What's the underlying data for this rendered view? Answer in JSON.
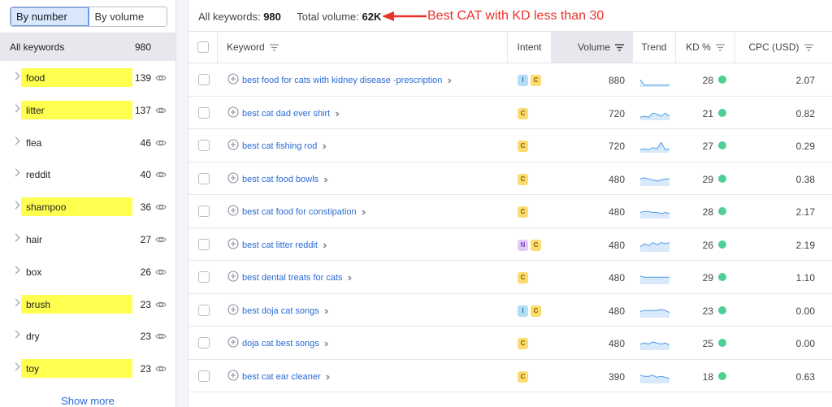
{
  "sidebar": {
    "toggle": {
      "by_number": "By number",
      "by_volume": "By volume"
    },
    "all_keywords": {
      "label": "All keywords",
      "count": "980"
    },
    "groups": [
      {
        "label": "food",
        "count": "139",
        "highlighted": true
      },
      {
        "label": "litter",
        "count": "137",
        "highlighted": true
      },
      {
        "label": "flea",
        "count": "46",
        "highlighted": false
      },
      {
        "label": "reddit",
        "count": "40",
        "highlighted": false
      },
      {
        "label": "shampoo",
        "count": "36",
        "highlighted": true
      },
      {
        "label": "hair",
        "count": "27",
        "highlighted": false
      },
      {
        "label": "box",
        "count": "26",
        "highlighted": false
      },
      {
        "label": "brush",
        "count": "23",
        "highlighted": true
      },
      {
        "label": "dry",
        "count": "23",
        "highlighted": false
      },
      {
        "label": "toy",
        "count": "23",
        "highlighted": true
      }
    ],
    "show_more": "Show more"
  },
  "summary": {
    "all_keywords_label": "All keywords:",
    "all_keywords_value": "980",
    "total_volume_label": "Total volume:",
    "total_volume_value": "62K",
    "annotation": "Best CAT with KD less than 30"
  },
  "table": {
    "headers": {
      "keyword": "Keyword",
      "intent": "Intent",
      "volume": "Volume",
      "trend": "Trend",
      "kd": "KD %",
      "cpc": "CPC (USD)"
    },
    "rows": [
      {
        "keyword": "best food for cats with kidney disease -prescription",
        "intent": [
          "I",
          "C"
        ],
        "volume": "880",
        "kd": "28",
        "cpc": "2.07",
        "trend": [
          0.6,
          0.1,
          0.1,
          0.1,
          0.1,
          0.1,
          0.1,
          0.1
        ]
      },
      {
        "keyword": "best cat dad ever shirt",
        "intent": [
          "C"
        ],
        "volume": "720",
        "kd": "21",
        "cpc": "0.82",
        "trend": [
          0.2,
          0.3,
          0.2,
          0.6,
          0.5,
          0.3,
          0.6,
          0.3
        ]
      },
      {
        "keyword": "best cat fishing rod",
        "intent": [
          "C"
        ],
        "volume": "720",
        "kd": "27",
        "cpc": "0.29",
        "trend": [
          0.2,
          0.3,
          0.2,
          0.4,
          0.3,
          0.9,
          0.2,
          0.3
        ]
      },
      {
        "keyword": "best cat food bowls",
        "intent": [
          "C"
        ],
        "volume": "480",
        "kd": "29",
        "cpc": "0.38",
        "trend": [
          0.6,
          0.7,
          0.6,
          0.5,
          0.4,
          0.5,
          0.6,
          0.6
        ]
      },
      {
        "keyword": "best cat food for constipation",
        "intent": [
          "C"
        ],
        "volume": "480",
        "kd": "28",
        "cpc": "2.17",
        "trend": [
          0.5,
          0.6,
          0.6,
          0.5,
          0.5,
          0.4,
          0.5,
          0.4
        ]
      },
      {
        "keyword": "best cat litter reddit",
        "intent": [
          "N",
          "C"
        ],
        "volume": "480",
        "kd": "26",
        "cpc": "2.19",
        "trend": [
          0.4,
          0.7,
          0.5,
          0.8,
          0.6,
          0.8,
          0.7,
          0.8
        ]
      },
      {
        "keyword": "best dental treats for cats",
        "intent": [
          "C"
        ],
        "volume": "480",
        "kd": "29",
        "cpc": "1.10",
        "trend": [
          0.7,
          0.6,
          0.6,
          0.6,
          0.6,
          0.6,
          0.6,
          0.6
        ]
      },
      {
        "keyword": "best doja cat songs",
        "intent": [
          "I",
          "C"
        ],
        "volume": "480",
        "kd": "23",
        "cpc": "0.00",
        "trend": [
          0.5,
          0.6,
          0.6,
          0.6,
          0.6,
          0.7,
          0.6,
          0.4
        ]
      },
      {
        "keyword": "doja cat best songs",
        "intent": [
          "C"
        ],
        "volume": "480",
        "kd": "25",
        "cpc": "0.00",
        "trend": [
          0.5,
          0.6,
          0.5,
          0.7,
          0.6,
          0.5,
          0.6,
          0.4
        ]
      },
      {
        "keyword": "best cat ear cleaner",
        "intent": [
          "C"
        ],
        "volume": "390",
        "kd": "18",
        "cpc": "0.63",
        "trend": [
          0.7,
          0.6,
          0.6,
          0.7,
          0.5,
          0.6,
          0.5,
          0.4
        ]
      }
    ]
  },
  "colors": {
    "highlight": "#ffff4f",
    "link": "#2a6ad4",
    "annotation": "#e8322a",
    "kd_easy": "#4fcf95",
    "trend_line": "#4f9be8",
    "trend_fill": "#d7e9fb"
  },
  "icons": {
    "eye": "eye-icon",
    "chevron": "chevron-right-icon",
    "plus": "plus-circle-icon",
    "sort": "sort-icon",
    "double_chevron": "double-chevron-icon"
  }
}
